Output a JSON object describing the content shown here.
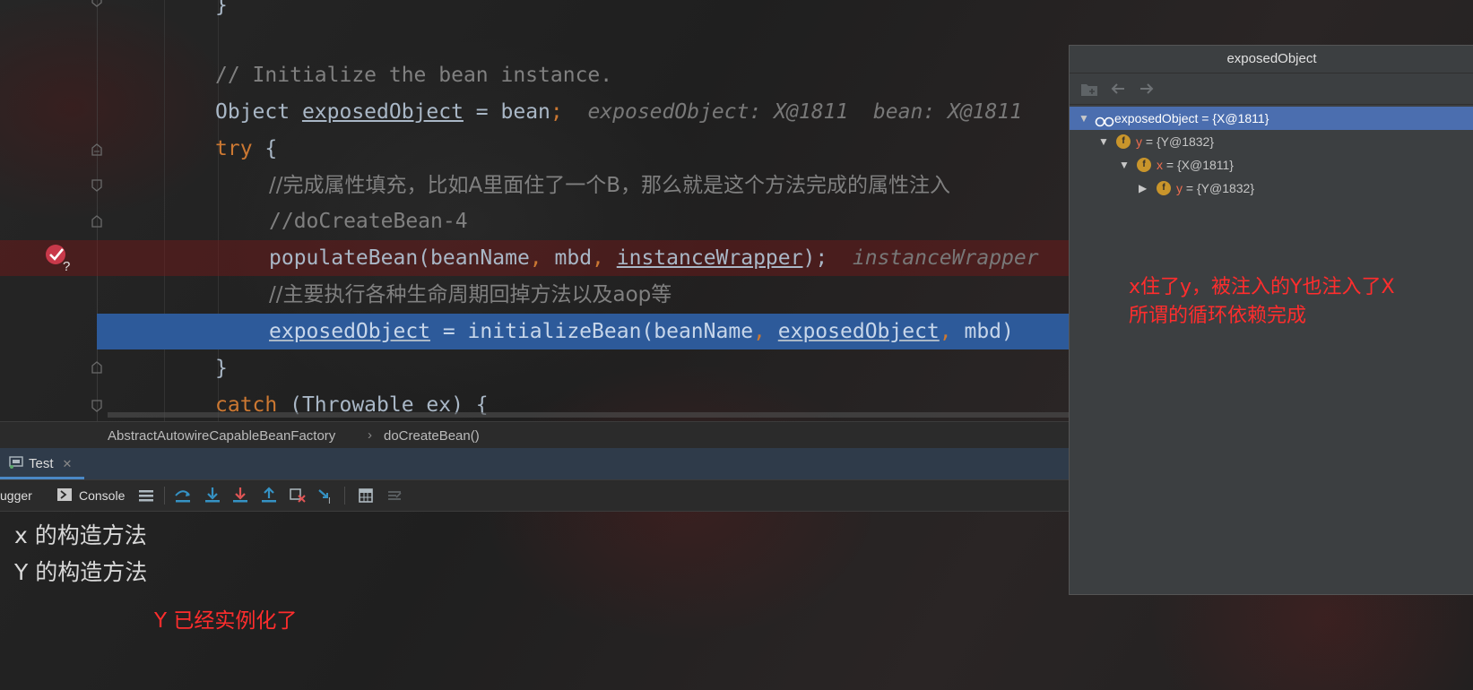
{
  "editor": {
    "lines": {
      "close_brace_top": "}",
      "comment_init": "// Initialize the bean instance.",
      "obj_type": "Object ",
      "obj_var": "exposedObject",
      "obj_assign": " = bean",
      "obj_semi": ";",
      "obj_hint": "  exposedObject: X@1811  bean: X@1811",
      "try_kw": "try",
      "try_brace": " {",
      "comment_populate": "//完成属性填充，比如A里面住了一个B，那么就是这个方法完成的属性注入",
      "comment_step": "//doCreateBean-4",
      "populate_call": "populateBean(beanName",
      "populate_c1": ",",
      "populate_mid": " mbd",
      "populate_c2": ",",
      "populate_wrapper": "instanceWrapper",
      "populate_end": ");",
      "populate_hint": "  instanceWrapper",
      "comment_lifecycle": "//主要执行各种生命周期回掉方法以及aop等",
      "init_var": "exposedObject",
      "init_call": " = initializeBean(beanName",
      "init_c1": ",",
      "init_arg": "exposedObject",
      "init_c2": ",",
      "init_end": " mbd)",
      "close_brace": "}",
      "catch_kw": "catch",
      "catch_rest": " (Throwable ex) {"
    }
  },
  "breadcrumb": {
    "class_name": "AbstractAutowireCapableBeanFactory",
    "separator": "›",
    "method_name": "doCreateBean()"
  },
  "tool_window": {
    "tab_label": "Test",
    "tab_close": "✕",
    "debugger_label": "ugger",
    "console_label": "Console"
  },
  "console": {
    "lines": [
      "x 的构造方法",
      "Y 的构造方法"
    ]
  },
  "annotations": {
    "bottom": "Y 已经实例化了",
    "right_line1": "x住了y，被注入的Y也注入了X",
    "right_line2": "所谓的循环依赖完成"
  },
  "popup": {
    "title": "exposedObject",
    "tree": [
      {
        "name": "exposedObject",
        "eq": " = ",
        "value": "{X@1811}"
      },
      {
        "name": "y",
        "eq": " = ",
        "value": "{Y@1832}"
      },
      {
        "name": "x",
        "eq": " = ",
        "value": "{X@1811}"
      },
      {
        "name": "y",
        "eq": " = ",
        "value": "{Y@1832}"
      }
    ]
  },
  "icons": {
    "breakpoint": "breakpoint-conditional-icon",
    "step_over": "step-over-icon",
    "step_into": "step-into-icon",
    "force_step_into": "force-step-into-icon",
    "step_out": "step-out-icon",
    "drop_frame": "drop-frame-icon",
    "run_to_cursor": "run-to-cursor-icon",
    "evaluate": "evaluate-expression-icon",
    "trace": "trace-icon"
  },
  "colors": {
    "selection": "#2d5a9a",
    "breakpoint_line": "#7a1919",
    "annotation": "#ff2d2d",
    "keyword": "#cc7832",
    "tree_selected": "#4b6eaf"
  }
}
